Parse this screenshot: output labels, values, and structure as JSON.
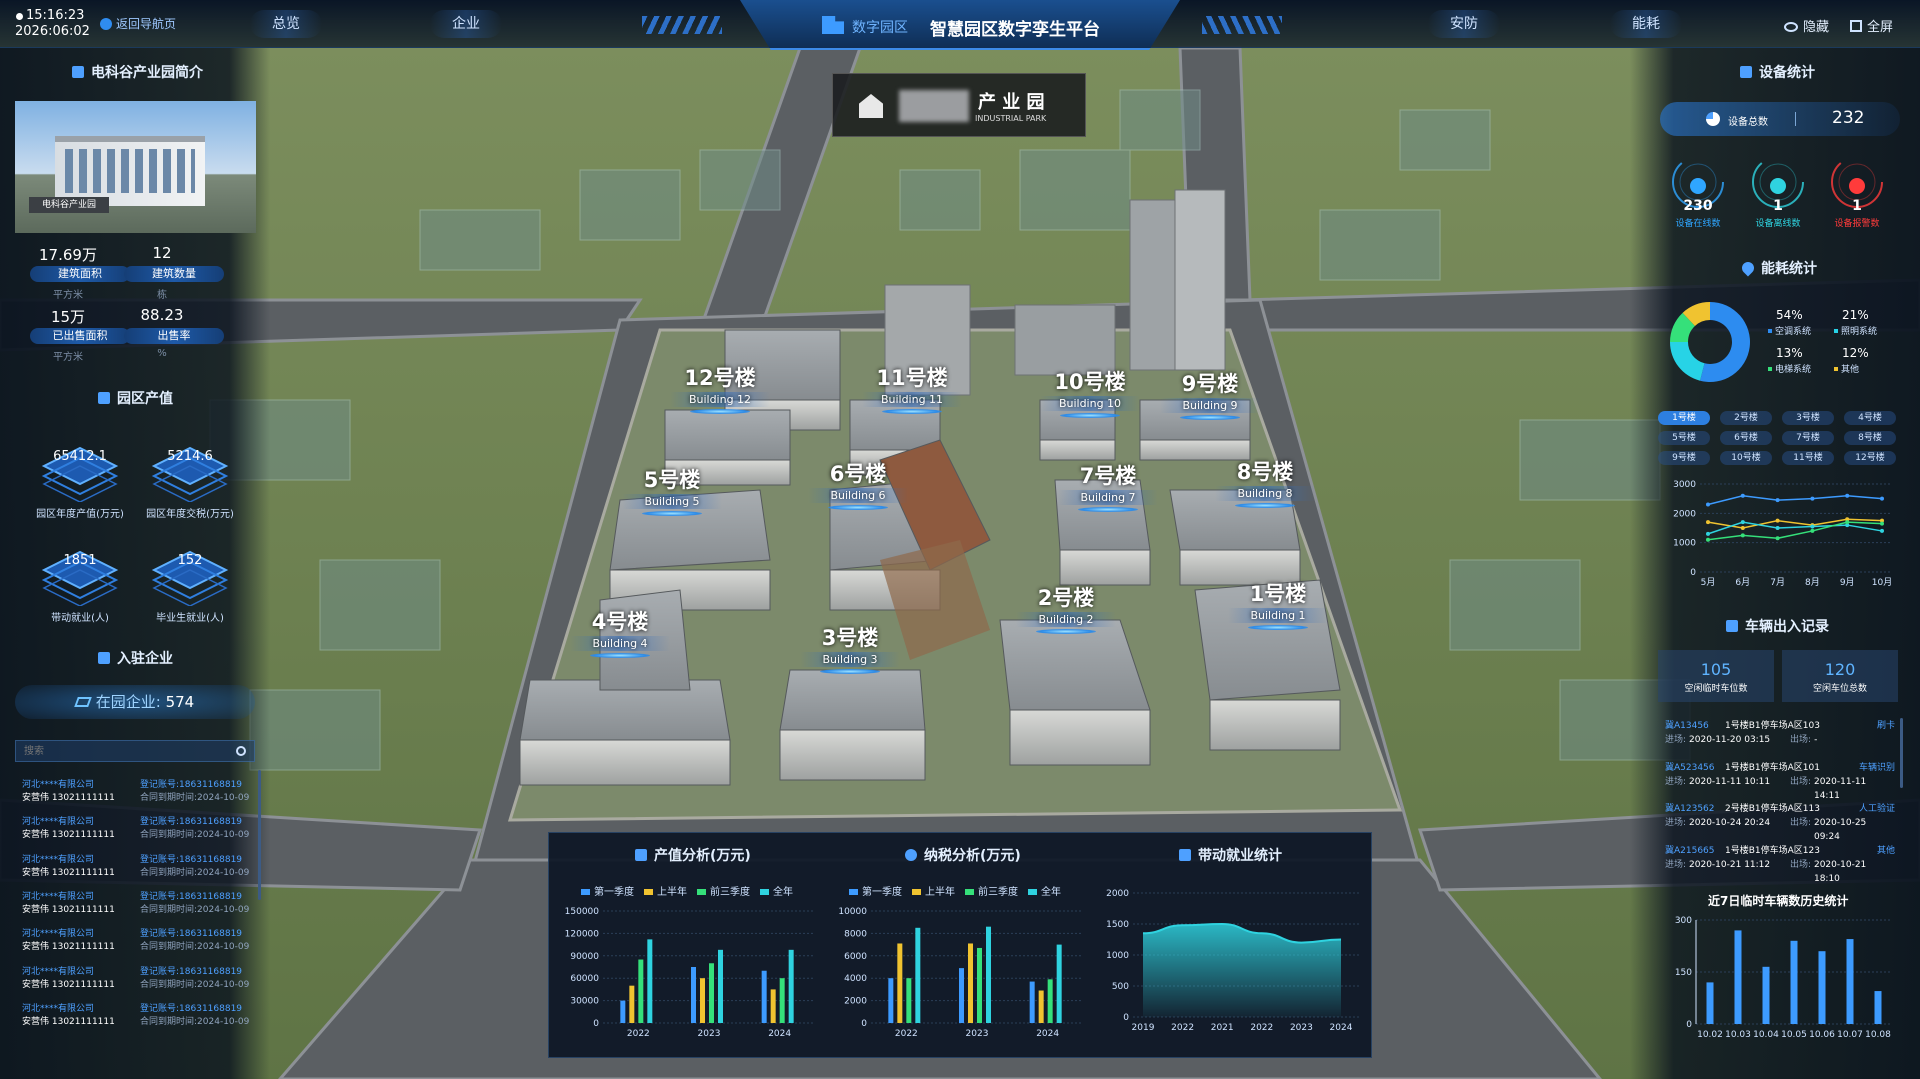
{
  "topbar": {
    "time": "15:16:23",
    "date": "2026:06:02",
    "back_label": "返回导航页",
    "nav_left": [
      "总览",
      "企业"
    ],
    "nav_right": [
      "安防",
      "能耗"
    ],
    "brand": "数字园区",
    "title": "智慧园区数字孪生平台",
    "hide_label": "隐藏",
    "fullscreen_label": "全屏"
  },
  "park_sign": {
    "cn": "产 业 园",
    "en": "INDUSTRIAL PARK"
  },
  "intro": {
    "title": "电科谷产业园简介",
    "photo_caption": "电科谷产业园",
    "stats": [
      {
        "value": "17.69万",
        "label": "建筑面积",
        "unit": "平方米"
      },
      {
        "value": "12",
        "label": "建筑数量",
        "unit": "栋"
      },
      {
        "value": "15万",
        "label": "已出售面积",
        "unit": "平方米"
      },
      {
        "value": "88.23",
        "label": "出售率",
        "unit": "%"
      }
    ]
  },
  "output": {
    "title": "园区产值",
    "items": [
      {
        "value": "65412.1",
        "label": "园区年度产值(万元)"
      },
      {
        "value": "5214.6",
        "label": "园区年度交税(万元)"
      },
      {
        "value": "1851",
        "label": "带动就业(人)"
      },
      {
        "value": "152",
        "label": "毕业生就业(人)"
      }
    ]
  },
  "enterprise": {
    "title": "入驻企业",
    "total_label": "在园企业:",
    "total": "574",
    "search_placeholder": "搜索",
    "rows": [
      {
        "name": "河北****有限公司",
        "reg_label": "登记账号:",
        "reg": "18631168819",
        "person": "安营伟 13021111111",
        "contract_label": "合同到期时间:",
        "contract": "2024-10-09"
      },
      {
        "name": "河北****有限公司",
        "reg_label": "登记账号:",
        "reg": "18631168819",
        "person": "安营伟 13021111111",
        "contract_label": "合同到期时间:",
        "contract": "2024-10-09"
      },
      {
        "name": "河北****有限公司",
        "reg_label": "登记账号:",
        "reg": "18631168819",
        "person": "安营伟 13021111111",
        "contract_label": "合同到期时间:",
        "contract": "2024-10-09"
      },
      {
        "name": "河北****有限公司",
        "reg_label": "登记账号:",
        "reg": "18631168819",
        "person": "安营伟 13021111111",
        "contract_label": "合同到期时间:",
        "contract": "2024-10-09"
      },
      {
        "name": "河北****有限公司",
        "reg_label": "登记账号:",
        "reg": "18631168819",
        "person": "安营伟 13021111111",
        "contract_label": "合同到期时间:",
        "contract": "2024-10-09"
      },
      {
        "name": "河北****有限公司",
        "reg_label": "登记账号:",
        "reg": "18631168819",
        "person": "安营伟 13021111111",
        "contract_label": "合同到期时间:",
        "contract": "2024-10-09"
      },
      {
        "name": "河北****有限公司",
        "reg_label": "登记账号:",
        "reg": "18631168819",
        "person": "安营伟 13021111111",
        "contract_label": "合同到期时间:",
        "contract": "2024-10-09"
      }
    ]
  },
  "buildings": [
    {
      "cn": "12号楼",
      "en": "Building 12"
    },
    {
      "cn": "11号楼",
      "en": "Building 11"
    },
    {
      "cn": "10号楼",
      "en": "Building 10"
    },
    {
      "cn": "9号楼",
      "en": "Building 9"
    },
    {
      "cn": "5号楼",
      "en": "Building 5"
    },
    {
      "cn": "6号楼",
      "en": "Building 6"
    },
    {
      "cn": "7号楼",
      "en": "Building 7"
    },
    {
      "cn": "8号楼",
      "en": "Building 8"
    },
    {
      "cn": "4号楼",
      "en": "Building 4"
    },
    {
      "cn": "3号楼",
      "en": "Building 3"
    },
    {
      "cn": "2号楼",
      "en": "Building 2"
    },
    {
      "cn": "1号楼",
      "en": "Building 1"
    }
  ],
  "devices": {
    "title": "设备统计",
    "total_label": "设备总数",
    "total": "232",
    "items": [
      {
        "value": "230",
        "label": "设备在线数",
        "color": "#2fa6ff"
      },
      {
        "value": "1",
        "label": "设备离线数",
        "color": "#2fd3e0"
      },
      {
        "value": "1",
        "label": "设备报警数",
        "color": "#ff3b3b"
      }
    ]
  },
  "energy": {
    "title": "能耗统计",
    "items": [
      {
        "pct": "54%",
        "label": "空调系统",
        "color": "#2d8cf0"
      },
      {
        "pct": "21%",
        "label": "照明系统",
        "color": "#27d3e6"
      },
      {
        "pct": "13%",
        "label": "电梯系统",
        "color": "#35e07a"
      },
      {
        "pct": "12%",
        "label": "其他",
        "color": "#f0c330"
      }
    ],
    "buttons": [
      "1号楼",
      "2号楼",
      "3号楼",
      "4号楼",
      "5号楼",
      "6号楼",
      "7号楼",
      "8号楼",
      "9号楼",
      "10号楼",
      "11号楼",
      "12号楼"
    ],
    "active": 0
  },
  "vehicles": {
    "title": "车辆出入记录",
    "stats": [
      {
        "value": "105",
        "label": "空闲临时车位数"
      },
      {
        "value": "120",
        "label": "空闲车位总数"
      }
    ],
    "records": [
      {
        "plate": "冀A13456",
        "loc": "1号楼B1停车场A区103",
        "type": "刷卡",
        "in_label": "进场:",
        "in": "2020-11-20 03:15",
        "out_label": "出场:",
        "out": "-"
      },
      {
        "plate": "冀A523456",
        "loc": "1号楼B1停车场A区101",
        "type": "车辆识别",
        "in_label": "进场:",
        "in": "2020-11-11 10:11",
        "out_label": "出场:",
        "out": "2020-11-11 14:11"
      },
      {
        "plate": "冀A123562",
        "loc": "2号楼B1停车场A区113",
        "type": "人工验证",
        "in_label": "进场:",
        "in": "2020-10-24 20:24",
        "out_label": "出场:",
        "out": "2020-10-25 09:24"
      },
      {
        "plate": "冀A215665",
        "loc": "1号楼B1停车场A区123",
        "type": "其他",
        "in_label": "进场:",
        "in": "2020-10-21 11:12",
        "out_label": "出场:",
        "out": "2020-10-21 18:10"
      }
    ],
    "hist_title": "近7日临时车辆数历史统计"
  },
  "bottom": {
    "titles": [
      "产值分析(万元)",
      "纳税分析(万元)",
      "带动就业统计"
    ]
  },
  "chart_data": [
    {
      "id": "energy-line",
      "type": "line",
      "categories": [
        "5月",
        "6月",
        "7月",
        "8月",
        "9月",
        "10月"
      ],
      "ylim": [
        0,
        3000
      ],
      "yticks": [
        0,
        1000,
        2000,
        3000
      ],
      "series": [
        {
          "values": [
            2300,
            2600,
            2450,
            2500,
            2600,
            2500
          ],
          "color": "#3d9bff"
        },
        {
          "values": [
            1700,
            1500,
            1750,
            1600,
            1800,
            1750
          ],
          "color": "#f0c330"
        },
        {
          "values": [
            1300,
            1700,
            1500,
            1550,
            1600,
            1400
          ],
          "color": "#2fd3e0"
        },
        {
          "values": [
            1100,
            1250,
            1150,
            1400,
            1700,
            1650
          ],
          "color": "#35e07a"
        }
      ]
    },
    {
      "id": "vehicle-bar",
      "type": "bar",
      "categories": [
        "10.02",
        "10.03",
        "10.04",
        "10.05",
        "10.06",
        "10.07",
        "10.08"
      ],
      "ylim": [
        0,
        300
      ],
      "yticks": [
        0,
        150,
        300
      ],
      "values": [
        120,
        270,
        165,
        240,
        210,
        245,
        95
      ],
      "color": "#3d9bff"
    },
    {
      "id": "output-bar",
      "type": "bar",
      "title": "产值分析(万元)",
      "categories": [
        "2022",
        "2023",
        "2024"
      ],
      "ylim": [
        0,
        150000
      ],
      "yticks": [
        0,
        30000,
        60000,
        90000,
        120000,
        150000
      ],
      "series": [
        {
          "name": "第一季度",
          "values": [
            30000,
            75000,
            70000
          ],
          "color": "#3d9bff"
        },
        {
          "name": "上半年",
          "values": [
            50000,
            60000,
            45000
          ],
          "color": "#f0c330"
        },
        {
          "name": "前三季度",
          "values": [
            85000,
            80000,
            60000
          ],
          "color": "#35e07a"
        },
        {
          "name": "全年",
          "values": [
            112000,
            98000,
            98000
          ],
          "color": "#2fd3e0"
        }
      ]
    },
    {
      "id": "tax-bar",
      "type": "bar",
      "title": "纳税分析(万元)",
      "categories": [
        "2022",
        "2023",
        "2024"
      ],
      "ylim": [
        0,
        10000
      ],
      "yticks": [
        0,
        2000,
        4000,
        6000,
        8000,
        10000
      ],
      "series": [
        {
          "name": "第一季度",
          "values": [
            4000,
            4900,
            3700
          ],
          "color": "#3d9bff"
        },
        {
          "name": "上半年",
          "values": [
            7100,
            7100,
            2900
          ],
          "color": "#f0c330"
        },
        {
          "name": "前三季度",
          "values": [
            4000,
            6700,
            3900
          ],
          "color": "#35e07a"
        },
        {
          "name": "全年",
          "values": [
            8500,
            8600,
            7000
          ],
          "color": "#2fd3e0"
        }
      ]
    },
    {
      "id": "employment-area",
      "type": "area",
      "title": "带动就业统计",
      "categories": [
        "2019",
        "2022",
        "2021",
        "2022",
        "2023",
        "2024"
      ],
      "ylim": [
        0,
        2000
      ],
      "yticks": [
        0,
        500,
        1000,
        1500,
        2000
      ],
      "values": [
        1350,
        1480,
        1500,
        1350,
        1200,
        1250
      ],
      "color": "#2fd3e0"
    }
  ]
}
